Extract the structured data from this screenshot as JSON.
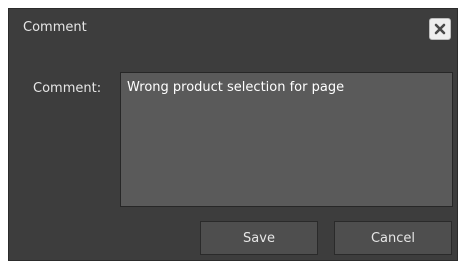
{
  "dialog": {
    "title": "Comment",
    "close_icon": "close-x-icon"
  },
  "form": {
    "comment_label": "Comment:",
    "comment_value": "Wrong product selection for page"
  },
  "buttons": {
    "save_label": "Save",
    "cancel_label": "Cancel"
  },
  "colors": {
    "dialog_background": "#3d3d3d",
    "field_background": "#5a5a5a",
    "button_background": "#4e4e4e",
    "text": "#e6e6e6"
  }
}
